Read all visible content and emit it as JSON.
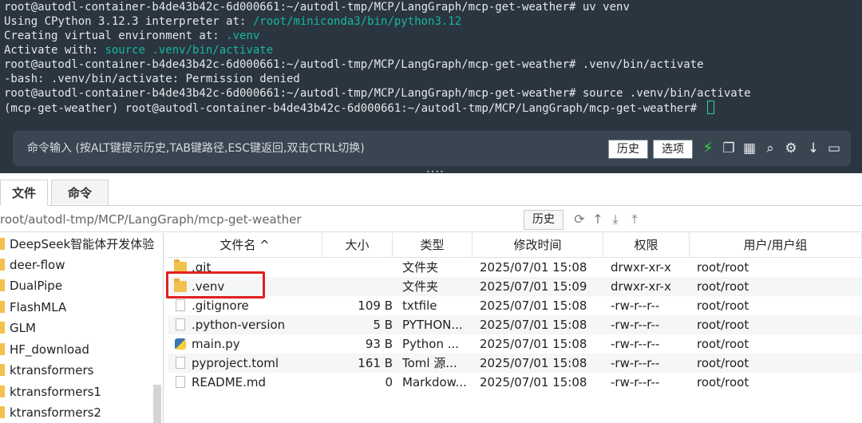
{
  "terminal": {
    "lines": [
      {
        "text": "root@autodl-container-b4de43b42c-6d000661:~/autodl-tmp/MCP/LangGraph/mcp-get-weather# uv venv"
      },
      {
        "text": "Using CPython 3.12.3 interpreter at: ",
        "hl": "/root/miniconda3/bin/python3.12"
      },
      {
        "text": "Creating virtual environment at: ",
        "hl": ".venv"
      },
      {
        "text": "Activate with: ",
        "hl": "source .venv/bin/activate"
      },
      {
        "text": "root@autodl-container-b4de43b42c-6d000661:~/autodl-tmp/MCP/LangGraph/mcp-get-weather# .venv/bin/activate"
      },
      {
        "text": "-bash: .venv/bin/activate: Permission denied"
      },
      {
        "text": "root@autodl-container-b4de43b42c-6d000661:~/autodl-tmp/MCP/LangGraph/mcp-get-weather# source .venv/bin/activate"
      },
      {
        "text": "(mcp-get-weather) root@autodl-container-b4de43b42c-6d000661:~/autodl-tmp/MCP/LangGraph/mcp-get-weather# "
      }
    ],
    "command_placeholder": "命令输入 (按ALT键提示历史,TAB键路径,ESC键返回,双击CTRL切换)",
    "history_button": "历史",
    "options_button": "选项",
    "toolbar_icons": [
      "lightning-icon",
      "copy-icon",
      "paste-icon",
      "search-icon",
      "gear-icon",
      "down-arrow-icon",
      "window-icon"
    ],
    "accent_color": "#16b79f"
  },
  "tabs": [
    {
      "label": "文件",
      "active": true
    },
    {
      "label": "命令",
      "active": false
    }
  ],
  "pathbar": {
    "path": "root/autodl-tmp/MCP/LangGraph/mcp-get-weather",
    "history_button": "历史",
    "icons": [
      "refresh-icon",
      "up-icon",
      "download-icon",
      "upload-icon"
    ]
  },
  "sidebar": {
    "items": [
      {
        "label": "DeepSeek智能体开发体验"
      },
      {
        "label": "deer-flow"
      },
      {
        "label": "DualPipe"
      },
      {
        "label": "FlashMLA"
      },
      {
        "label": "GLM"
      },
      {
        "label": "HF_download"
      },
      {
        "label": "ktransformers"
      },
      {
        "label": "ktransformers1"
      },
      {
        "label": "ktransformers2"
      }
    ]
  },
  "filelist": {
    "columns": {
      "name": "文件名 ^",
      "size": "大小",
      "type": "类型",
      "mtime": "修改时间",
      "perm": "权限",
      "owner": "用户/用户组"
    },
    "rows": [
      {
        "name": ".git",
        "size": "",
        "type": "文件夹",
        "mtime": "2025/07/01 15:08",
        "perm": "drwxr-xr-x",
        "owner": "root/root",
        "icon": "folder"
      },
      {
        "name": ".venv",
        "size": "",
        "type": "文件夹",
        "mtime": "2025/07/01 15:09",
        "perm": "drwxr-xr-x",
        "owner": "root/root",
        "icon": "folder"
      },
      {
        "name": ".gitignore",
        "size": "109 B",
        "type": "txtfile",
        "mtime": "2025/07/01 15:08",
        "perm": "-rw-r--r--",
        "owner": "root/root",
        "icon": "doc"
      },
      {
        "name": ".python-version",
        "size": "5 B",
        "type": "PYTHON...",
        "mtime": "2025/07/01 15:08",
        "perm": "-rw-r--r--",
        "owner": "root/root",
        "icon": "doc"
      },
      {
        "name": "main.py",
        "size": "93 B",
        "type": "Python ...",
        "mtime": "2025/07/01 15:08",
        "perm": "-rw-r--r--",
        "owner": "root/root",
        "icon": "py"
      },
      {
        "name": "pyproject.toml",
        "size": "161 B",
        "type": "Toml 源...",
        "mtime": "2025/07/01 15:08",
        "perm": "-rw-r--r--",
        "owner": "root/root",
        "icon": "doc"
      },
      {
        "name": "README.md",
        "size": "0",
        "type": "Markdow...",
        "mtime": "2025/07/01 15:08",
        "perm": "-rw-r--r--",
        "owner": "root/root",
        "icon": "doc"
      }
    ]
  }
}
